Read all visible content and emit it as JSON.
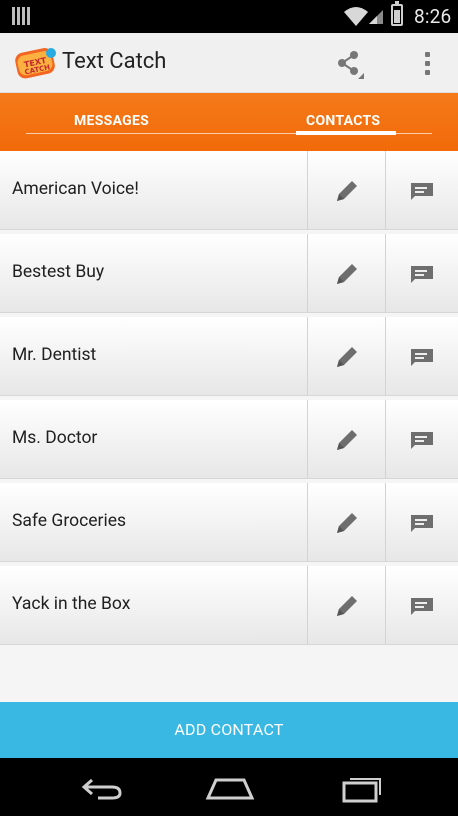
{
  "status_bar": {
    "time": "8:26"
  },
  "action_bar": {
    "title": "Text Catch",
    "logo_text": "TEXT CATCH"
  },
  "tabs": {
    "messages": "MESSAGES",
    "contacts": "CONTACTS",
    "selected": "contacts"
  },
  "contacts": [
    {
      "name": "American Voice!"
    },
    {
      "name": "Bestest Buy"
    },
    {
      "name": "Mr. Dentist"
    },
    {
      "name": "Ms. Doctor"
    },
    {
      "name": "Safe Groceries"
    },
    {
      "name": "Yack in the Box"
    }
  ],
  "buttons": {
    "add_contact": "ADD CONTACT"
  },
  "icons": {
    "share": "share-icon",
    "overflow": "overflow-menu-icon",
    "edit": "pencil-icon",
    "message": "message-icon",
    "back": "back-icon",
    "home": "home-icon",
    "recents": "recents-icon"
  },
  "colors": {
    "tab_bar": "#f47a19",
    "add_button": "#39b8e3"
  }
}
